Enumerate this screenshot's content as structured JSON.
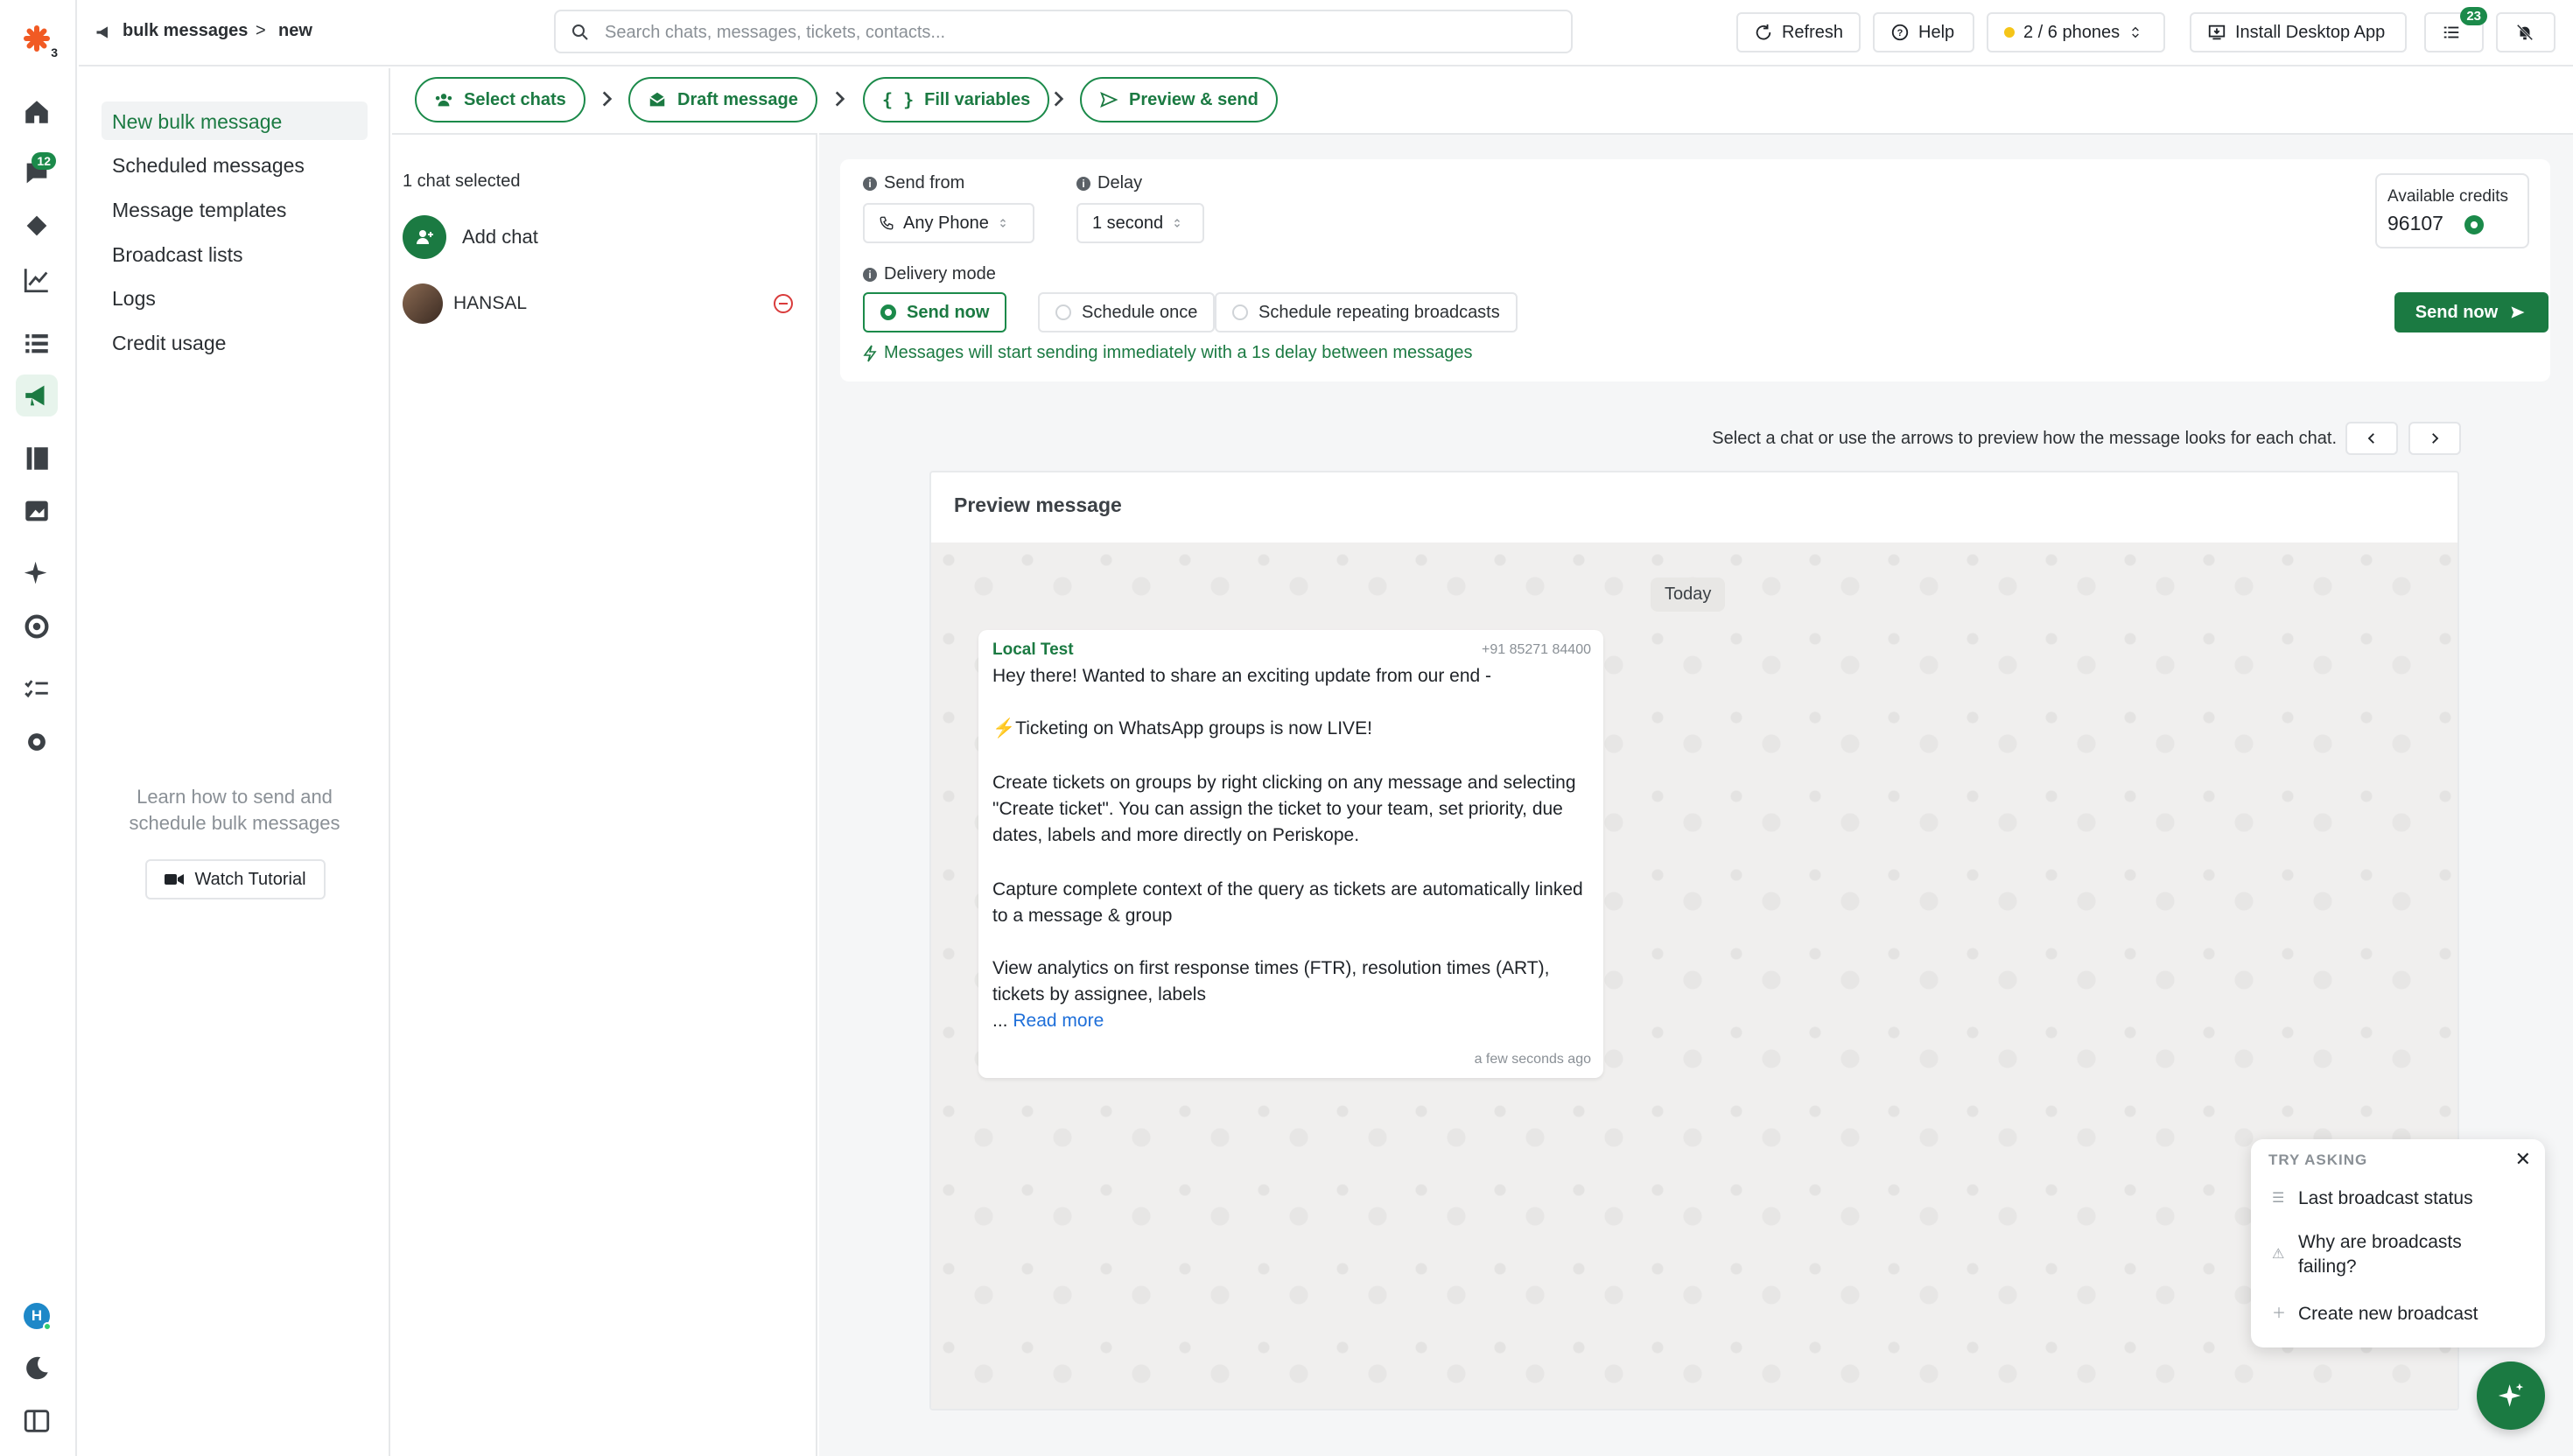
{
  "rail": {
    "logo_badge": "3",
    "chat_badge": "12",
    "avatar_letter": "H"
  },
  "topbar": {
    "breadcrumb_1": "bulk messages",
    "separator": ">",
    "breadcrumb_2": "new",
    "search_placeholder": "Search chats, messages, tickets, contacts...",
    "refresh": "Refresh",
    "help": "Help",
    "phones": "2 / 6 phones",
    "install": "Install Desktop App",
    "tasks_badge": "23"
  },
  "leftnav": {
    "items": [
      {
        "label": "New bulk message"
      },
      {
        "label": "Scheduled messages"
      },
      {
        "label": "Message templates"
      },
      {
        "label": "Broadcast lists"
      },
      {
        "label": "Logs"
      },
      {
        "label": "Credit usage"
      }
    ],
    "learn_line1": "Learn how to send and",
    "learn_line2": "schedule bulk messages",
    "watch": "Watch Tutorial"
  },
  "steps": [
    {
      "label": "Select chats"
    },
    {
      "label": "Draft message"
    },
    {
      "label": "Fill variables"
    },
    {
      "label": "Preview & send"
    }
  ],
  "chats": {
    "count_label": "1 chat selected",
    "add_chat": "Add chat",
    "items": [
      {
        "name": "HANSAL"
      }
    ]
  },
  "settings": {
    "send_from_label": "Send from",
    "send_from_value": "Any Phone",
    "delay_label": "Delay",
    "delay_value": "1 second",
    "delivery_label": "Delivery mode",
    "modes": [
      {
        "label": "Send now",
        "selected": true
      },
      {
        "label": "Schedule once",
        "selected": false
      },
      {
        "label": "Schedule repeating broadcasts",
        "selected": false
      }
    ],
    "note": "Messages will start sending immediately with a 1s delay between messages",
    "credits_label": "Available credits",
    "credits_value": "96107",
    "send_now": "Send now"
  },
  "preview": {
    "hint": "Select a chat or use the arrows to preview how the message looks for each chat.",
    "title": "Preview message",
    "day": "Today",
    "sender": "Local Test",
    "phone": "+91 85271 84400",
    "lines": [
      "Hey there! Wanted to share an exciting update from our end -",
      "⚡Ticketing on WhatsApp groups is now LIVE!",
      " Create tickets on groups by right clicking on any message and selecting \"Create ticket\". You can assign the ticket to your team, set priority, due dates, labels and more directly on Periskope.",
      " Capture complete context of the query as tickets are automatically linked to a message & group",
      " View analytics on first response times (FTR), resolution times (ART), tickets by assignee, labels"
    ],
    "ellipsis": "...",
    "read_more": "Read more",
    "time": "a few seconds ago"
  },
  "try_asking": {
    "title": "TRY ASKING",
    "items": [
      {
        "label": "Last broadcast status"
      },
      {
        "label": "Why are broadcasts failing?"
      },
      {
        "label": "Create new broadcast"
      }
    ]
  },
  "colors": {
    "brand": "#1b7a42",
    "accent_orange": "#f15a24"
  }
}
